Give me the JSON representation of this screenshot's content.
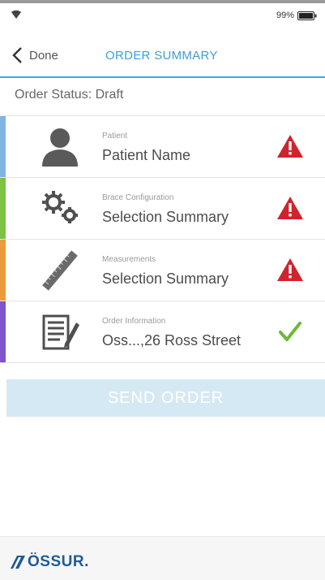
{
  "status_bar": {
    "battery_text": "99%"
  },
  "nav": {
    "back_label": "Done",
    "title": "ORDER SUMMARY"
  },
  "order_status": "Order Status: Draft",
  "items": [
    {
      "sub": "Patient",
      "main": "Patient Name",
      "accent": "#80b5e3",
      "icon": "person-icon",
      "status": "warning-icon"
    },
    {
      "sub": "Brace Configuration",
      "main": "Selection Summary",
      "accent": "#7cc243",
      "icon": "gears-icon",
      "status": "warning-icon"
    },
    {
      "sub": "Measurements",
      "main": "Selection Summary",
      "accent": "#ec9a3c",
      "icon": "ruler-icon",
      "status": "warning-icon"
    },
    {
      "sub": "Order Information",
      "main": "Oss...,26 Ross Street",
      "accent": "#7d54c9",
      "icon": "document-icon",
      "status": "check-icon"
    }
  ],
  "send_button": "SEND ORDER",
  "footer": {
    "logo_text": "ÖSSUR."
  },
  "colors": {
    "accent_blue": "#3d9ed8",
    "warning_red": "#d0232c",
    "check_green": "#6fb63a",
    "send_bg": "#d5e9f5"
  }
}
